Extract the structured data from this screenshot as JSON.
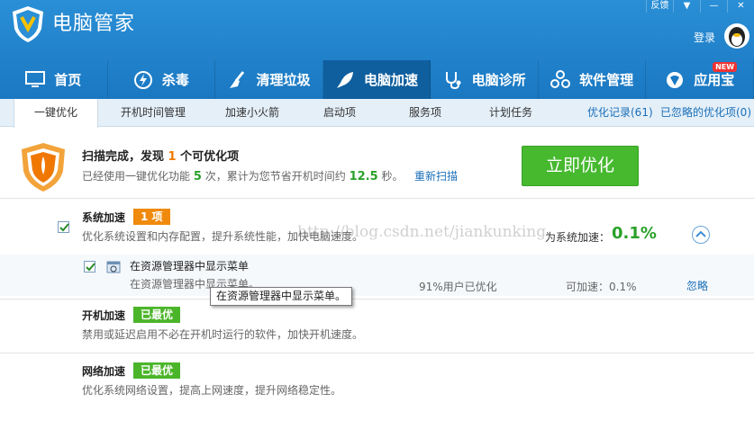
{
  "app": {
    "title": "电脑管家",
    "window_controls": [
      "反馈",
      "",
      "",
      ""
    ],
    "login": "登录"
  },
  "tabs": [
    {
      "label": "首页",
      "icon": "monitor-icon"
    },
    {
      "label": "杀毒",
      "icon": "lightning-icon"
    },
    {
      "label": "清理垃圾",
      "icon": "broom-icon"
    },
    {
      "label": "电脑加速",
      "icon": "rocket-icon"
    },
    {
      "label": "电脑诊所",
      "icon": "stethoscope-icon"
    },
    {
      "label": "软件管理",
      "icon": "app-grid-icon"
    },
    {
      "label": "应用宝",
      "icon": "app-store-icon",
      "badge": "NEW"
    }
  ],
  "subnav": {
    "items": [
      "一键优化",
      "开机时间管理",
      "加速小火箭",
      "启动项",
      "服务项",
      "计划任务"
    ],
    "history": "优化记录(61)",
    "ignored": "已忽略的优化项(0)"
  },
  "summary": {
    "t1": "扫描完成，发现",
    "count": "1",
    "t2": "个可优化项",
    "d1": "已经使用一键优化功能",
    "times": "5",
    "d2": "次，累计为您节省开机时间约",
    "secs": "12.5",
    "d3": "秒。",
    "rescan": "重新扫描",
    "button": "立即优化"
  },
  "system": {
    "title": "系统加速",
    "badge": "1 项",
    "desc": "优化系统设置和内存配置，提升系统性能，加快电脑速度。",
    "accel_label": "为系统加速：",
    "accel_value": "0.1%"
  },
  "item": {
    "title": "在资源管理器中显示菜单",
    "desc": "在资源管理器中显示菜单。",
    "users": "91%用户已优化",
    "gain": "可加速：0.1%",
    "ignore": "忽略",
    "tooltip": "在资源管理器中显示菜单。"
  },
  "boot": {
    "title": "开机加速",
    "badge": "已最优",
    "desc": "禁用或延迟启用不必在开机时运行的软件，加快开机速度。"
  },
  "network": {
    "title": "网络加速",
    "badge": "已最优",
    "desc": "优化系统网络设置，提高上网速度，提升网络稳定性。"
  },
  "watermark": "http://blog.csdn.net/jiankunking",
  "colors": {
    "header": "#1a78c2",
    "active_tab": "#0f5f9e",
    "optimize": "#46b92f",
    "highlight": "#f07800",
    "best": "#4bb52a"
  }
}
